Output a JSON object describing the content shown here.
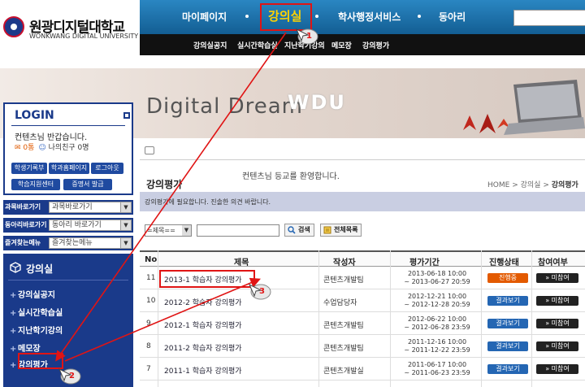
{
  "logo": {
    "korean": "원광디지털대학교",
    "english": "WONKWANG DIGITAL UNIVERSITY"
  },
  "topnav": {
    "items": [
      "마이페이지",
      "강의실",
      "학사행정서비스",
      "동아리"
    ],
    "active_index": 1,
    "sub_items": [
      "강의실공지",
      "실시간학습실",
      "지난학기강의",
      "메모장",
      "강의평가"
    ]
  },
  "banner": {
    "text1": "Digital Dream",
    "text2": "WDU"
  },
  "login": {
    "title": "LOGIN",
    "greeting": "컨텐츠님 반갑습니다.",
    "points": "0통",
    "friends": "나의친구 0명",
    "buttons": [
      "학생기록부",
      "학과홈페이지",
      "로그아웃",
      "학습지원센터",
      "증명서 발급"
    ]
  },
  "sidebar": {
    "selects": [
      {
        "label": "과목바로가기",
        "value": "과목바로가기"
      },
      {
        "label": "동아리바로가기",
        "value": "동아리 바로가기"
      },
      {
        "label": "즐겨찾는메뉴",
        "value": "즐겨찾는메뉴"
      }
    ],
    "menu_title": "강의실",
    "menu_items": [
      "강의실공지",
      "실시간학습실",
      "지난학기강의",
      "메모장",
      "강의평가"
    ]
  },
  "content": {
    "welcome": "컨텐츠님 등교를 환영합니다.",
    "page_title": "강의평가",
    "breadcrumb": [
      "HOME",
      "강의실",
      "강의평가"
    ],
    "notice": "강의평가에 필요합니다. 진솔한 의견 바랍니다.",
    "search": {
      "select_value": "=제목==",
      "search_label": "검색",
      "list_label": "전체목록"
    },
    "table": {
      "headers": [
        "No",
        "제목",
        "작성자",
        "평가기간",
        "진행상태",
        "참여여부"
      ],
      "rows": [
        {
          "no": "11",
          "title": "2013-1 학습자 강의평가",
          "author": "콘텐츠개발팀",
          "start": "2013-06-18 10:00",
          "end": "~ 2013-06-27 20:59",
          "status": "진행중",
          "status_type": "ing",
          "part": "» 미참여"
        },
        {
          "no": "10",
          "title": "2012-2 학습자 강의평가",
          "author": "수업담당자",
          "start": "2012-12-21 10:00",
          "end": "~ 2012-12-28 20:59",
          "status": "결과보기",
          "status_type": "done",
          "part": "» 미참여"
        },
        {
          "no": "9",
          "title": "2012-1 학습자 강의평가",
          "author": "콘텐츠개발팀",
          "start": "2012-06-22 10:00",
          "end": "~ 2012-06-28 23:59",
          "status": "결과보기",
          "status_type": "done",
          "part": "» 미참여"
        },
        {
          "no": "8",
          "title": "2011-2 학습자 강의평가",
          "author": "콘텐츠개발팀",
          "start": "2011-12-16 10:00",
          "end": "~ 2011-12-22 23:59",
          "status": "결과보기",
          "status_type": "done",
          "part": "» 미참여"
        },
        {
          "no": "7",
          "title": "2011-1 학습자 강의평가",
          "author": "콘텐츠개발실",
          "start": "2011-06-17 10:00",
          "end": "~ 2011-06-23 23:59",
          "status": "결과보기",
          "status_type": "done",
          "part": "» 미참여"
        }
      ]
    }
  },
  "annotations": [
    "1",
    "2",
    "3"
  ],
  "colors": {
    "nav_blue": "#1a6fa8",
    "sidebar_navy": "#1a3a8a",
    "active_gold": "#ffd200",
    "highlight_red": "#e01414",
    "status_ing": "#e35a00",
    "status_done": "#2466b3"
  }
}
